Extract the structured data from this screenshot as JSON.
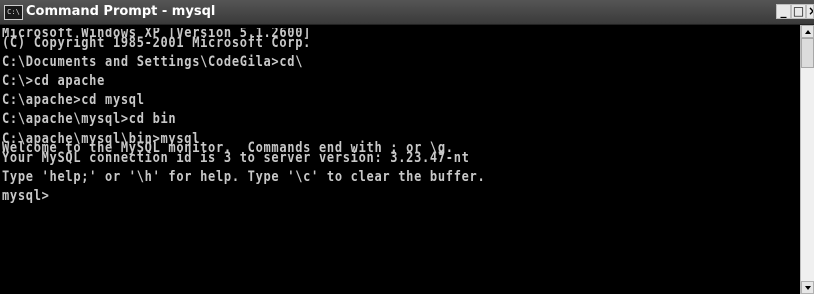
{
  "window": {
    "title": "Command Prompt - mysql",
    "icon_label": "C:\\",
    "controls": {
      "minimize": "_",
      "maximize": "□",
      "close": "×"
    }
  },
  "console": {
    "lines": [
      "Microsoft Windows XP [Version 5.1.2600]",
      "(C) Copyright 1985-2001 Microsoft Corp.",
      "",
      "C:\\Documents and Settings\\CodeGila>cd\\",
      "",
      "C:\\>cd apache",
      "",
      "C:\\apache>cd mysql",
      "",
      "C:\\apache\\mysql>cd bin",
      "",
      "C:\\apache\\mysql\\bin>mysql",
      "Welcome to the MySQL monitor.  Commands end with ; or \\g.",
      "Your MySQL connection id is 3 to server version: 3.23.47-nt",
      "",
      "Type 'help;' or '\\h' for help. Type '\\c' to clear the buffer.",
      "",
      "mysql>"
    ]
  },
  "colors": {
    "console_bg": "#000000",
    "console_text": "#c8c8c8",
    "titlebar": "#444444"
  }
}
